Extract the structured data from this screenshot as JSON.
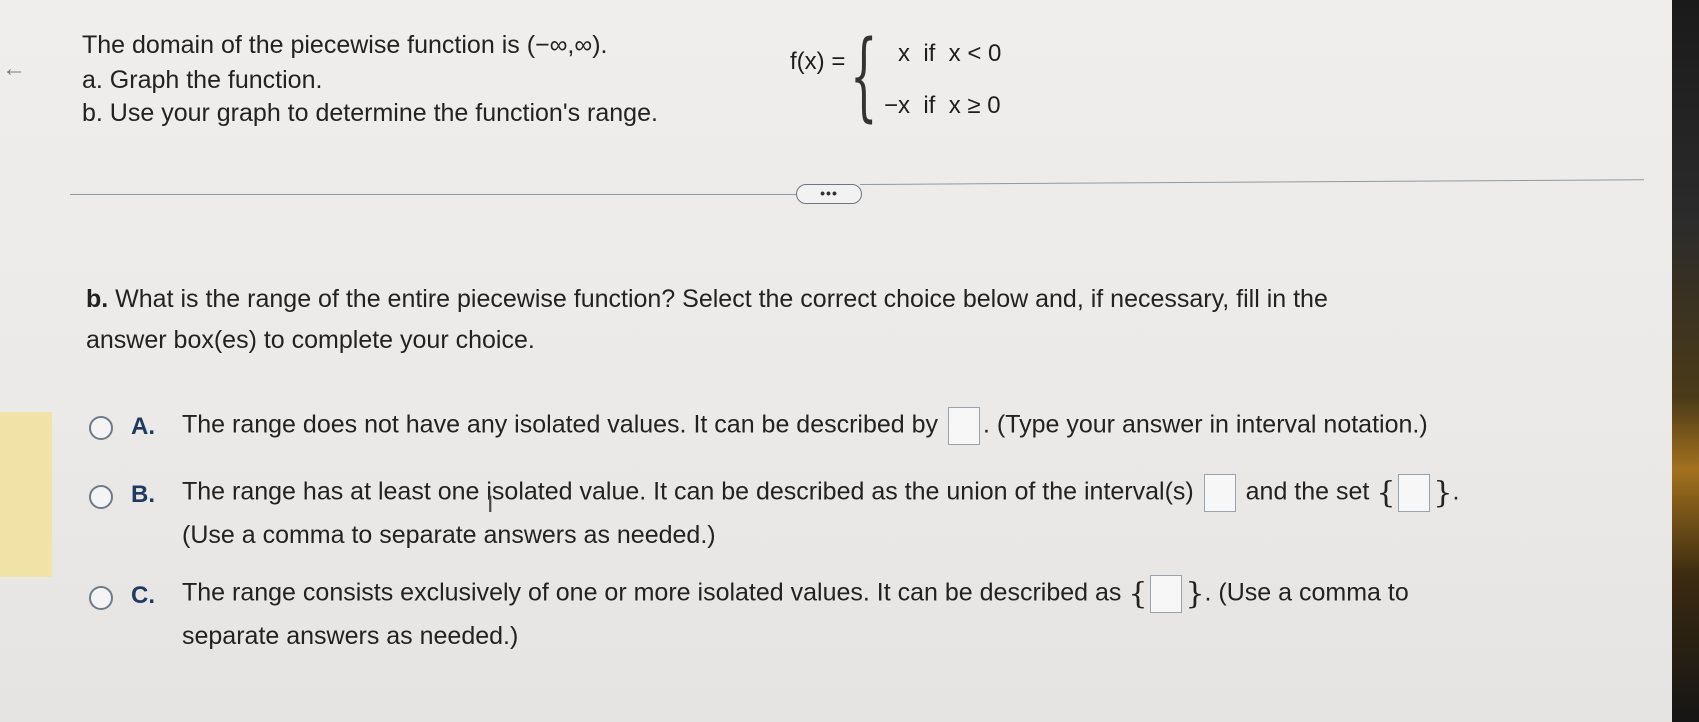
{
  "question": {
    "line1": "The domain of the piecewise function is (−∞,∞).",
    "line2": "a. Graph the function.",
    "line3": "b. Use your graph to determine the function's range."
  },
  "function": {
    "lhs": "f(x) =",
    "case1": "x  if  x < 0",
    "case2": "−x  if  x ≥ 0"
  },
  "more_label": "•••",
  "part_b": {
    "prefix": "b.",
    "line1": " What is the range of the entire piecewise function? Select the correct choice below and, if necessary, fill in the",
    "line2": "answer box(es) to complete your choice."
  },
  "options": {
    "a": {
      "letter": "A.",
      "text_before": "The range does not have any isolated values. It can be described by",
      "text_after": ". (Type your answer in interval notation.)"
    },
    "b": {
      "letter": "B.",
      "text_before": "The range has at least one isolated value. It can be described as the union of the interval(s)",
      "text_mid": "and the set",
      "text_after": ".",
      "line2": "(Use a comma to separate answers as needed.)"
    },
    "c": {
      "letter": "C.",
      "text_before": "The range consists exclusively of one or more isolated values. It can be described as",
      "text_after": ". (Use a comma to",
      "line2": "separate answers as needed.)"
    }
  },
  "set_open": "{",
  "set_close": "}",
  "icons": {
    "back": "arrow-left-icon",
    "cursor": "text-cursor-icon"
  }
}
